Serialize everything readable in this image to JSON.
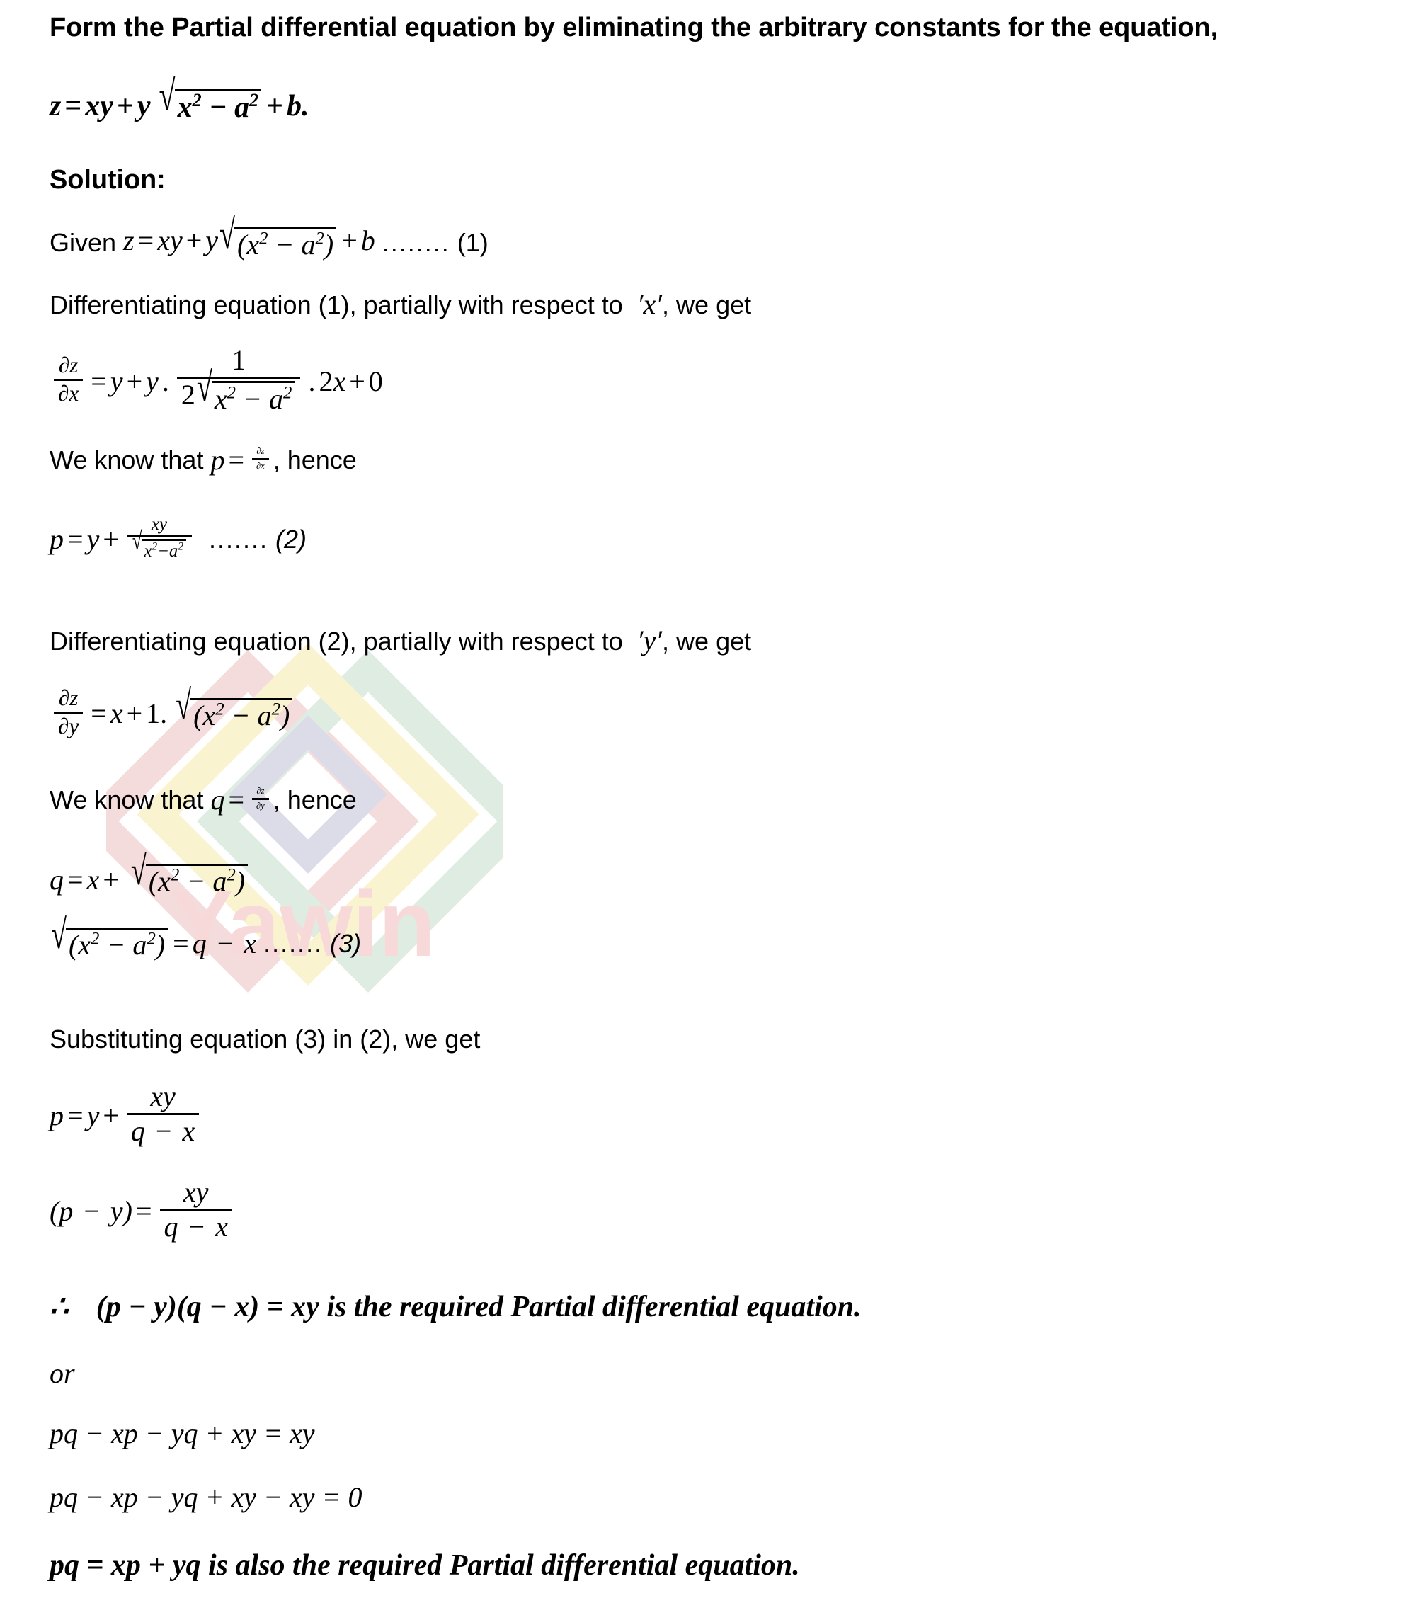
{
  "document": {
    "type": "math-solution-worksheet",
    "background_color": "#ffffff",
    "text_color": "#000000"
  },
  "watermark": {
    "brand_text": "Yawin",
    "brand_text_color": "#f7d9d9",
    "logo_colors": {
      "pink": "#f5dcdc",
      "yellow": "#faf3d0",
      "green": "#dfece2",
      "lavender": "#dcdce8"
    }
  },
  "content": {
    "question_heading": "Form the Partial differential equation by eliminating the arbitrary constants for the equation,",
    "question_equation": {
      "lhs": "z",
      "eq": "=",
      "term1": "xy",
      "plus": "+",
      "coeff": "y",
      "radicand": "x² − a²",
      "plus2": "+",
      "term3": "b",
      "period": "."
    },
    "solution_label": "Solution:",
    "steps": [
      {
        "id": "given",
        "kind": "text-with-math",
        "prefix": "Given",
        "math": "z = xy + y√(x² − a²) + b",
        "dots": "........",
        "tag": "(1)"
      },
      {
        "id": "diff-wrt-x",
        "kind": "text",
        "text_before": "Differentiating equation (1), partially with respect to ",
        "variable": "′x′",
        "text_after": ", we get"
      },
      {
        "id": "dzdx-expansion",
        "kind": "equation",
        "lhs_num": "∂z",
        "lhs_den": "∂x",
        "eq": "=",
        "rhs": "y + y . 1/(2√(x² − a²)) . 2x + 0",
        "frac_num": "1",
        "frac_den_coeff": "2",
        "frac_den_radicand": "x² − a²",
        "tail": ". 2x + 0"
      },
      {
        "id": "p-definition",
        "kind": "text-with-math",
        "text_before": "We know that ",
        "symbol": "p",
        "eq": "=",
        "frac_num": "∂z",
        "frac_den": "∂x",
        "text_after": ", hence"
      },
      {
        "id": "p-equation",
        "kind": "equation",
        "lhs": "p",
        "eq": "=",
        "term": "y",
        "plus": "+",
        "frac_num": "xy",
        "frac_den_radicand": "x²−a²",
        "dots": ".......",
        "tag": "(2)"
      },
      {
        "id": "diff-wrt-y",
        "kind": "text",
        "text_before": "Differentiating equation (2), partially with respect to ",
        "variable": "′y′",
        "text_after": ", we get"
      },
      {
        "id": "dzdy-expansion",
        "kind": "equation",
        "lhs_num": "∂z",
        "lhs_den": "∂y",
        "eq": "=",
        "rhs_head": "x + 1.",
        "radicand": "(x² − a²)"
      },
      {
        "id": "q-definition",
        "kind": "text-with-math",
        "text_before": "We know that ",
        "symbol": "q",
        "eq": "=",
        "frac_num": "∂z",
        "frac_den": "∂y",
        "text_after": ", hence"
      },
      {
        "id": "q-equation",
        "kind": "equation",
        "lhs": "q",
        "eq": "=",
        "term": "x",
        "plus": "+",
        "radicand": "(x² − a²)"
      },
      {
        "id": "radical-isolated",
        "kind": "equation",
        "radicand": "(x² − a²)",
        "eq": "=",
        "rhs": "q − x",
        "dots": ".......",
        "tag": "(3)"
      },
      {
        "id": "substitution-note",
        "kind": "text",
        "text": "Substituting equation (3) in (2), we get"
      },
      {
        "id": "p-substituted",
        "kind": "equation",
        "lhs": "p",
        "eq": "=",
        "term": "y",
        "plus": "+",
        "frac_num": "xy",
        "frac_den": "q − x"
      },
      {
        "id": "p-minus-y",
        "kind": "equation",
        "lhs": "(p − y)",
        "eq": "=",
        "frac_num": "xy",
        "frac_den": "q − x"
      },
      {
        "id": "final-answer-1",
        "kind": "conclusion",
        "therefore": "∴",
        "equation": "(p − y)(q − x) = xy",
        "text": " is the required Partial differential equation."
      },
      {
        "id": "or-separator",
        "kind": "math-text",
        "text": "or"
      },
      {
        "id": "expanded-1",
        "kind": "equation",
        "text": "pq − xp − yq + xy = xy"
      },
      {
        "id": "expanded-2",
        "kind": "equation",
        "text": "pq − xp − yq + xy − xy = 0"
      },
      {
        "id": "final-answer-2",
        "kind": "conclusion",
        "equation": "pq = xp + yq",
        "text": "  is also the required Partial differential equation."
      }
    ]
  },
  "glyphs": {
    "partial": "∂",
    "radical": "√",
    "therefore": "∴",
    "minus": "−",
    "plus": "+",
    "equals": "=",
    "prime": "′",
    "superscript_two": "2"
  }
}
